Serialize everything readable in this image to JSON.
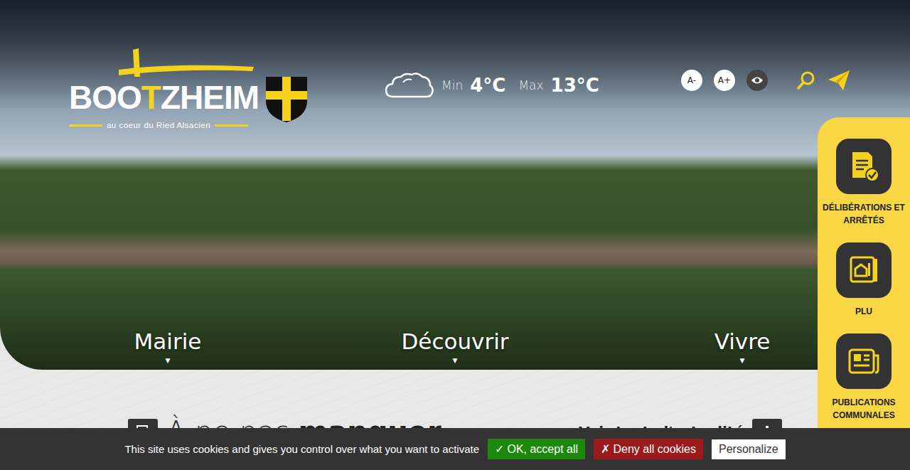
{
  "logo": {
    "parts": [
      {
        "text": "BOO",
        "accent": false
      },
      {
        "text": "T",
        "accent": true
      },
      {
        "text": "ZHEIM",
        "accent": false
      }
    ],
    "tagline": "au coeur du Ried Alsacien"
  },
  "weather": {
    "min_label": "Min",
    "min": "4°C",
    "max_label": "Max",
    "max": "13°C"
  },
  "tools": {
    "smaller": "A-",
    "larger": "A+"
  },
  "nav": [
    {
      "label": "Mairie",
      "caret": "▼"
    },
    {
      "label": "Découvrir",
      "caret": "▼"
    },
    {
      "label": "Vivre",
      "caret": "▼"
    }
  ],
  "quick_links": [
    {
      "label": "DÉLIBÉRATIONS ET ARRÊTÉS"
    },
    {
      "label": "PLU"
    },
    {
      "label": "PUBLICATIONS COMMUNALES"
    }
  ],
  "section": {
    "title_light": "À ne pas",
    "title_bold": "manquer",
    "link": "Voir toute l'actualité"
  },
  "cookie_bar": {
    "message": "This site uses cookies and gives you control over what you want to activate",
    "buttons": [
      {
        "label": "✓ OK, accept all",
        "kind": "accept"
      },
      {
        "label": "✗ Deny all cookies",
        "kind": "deny"
      },
      {
        "label": "Personalize",
        "kind": "customize"
      }
    ]
  }
}
